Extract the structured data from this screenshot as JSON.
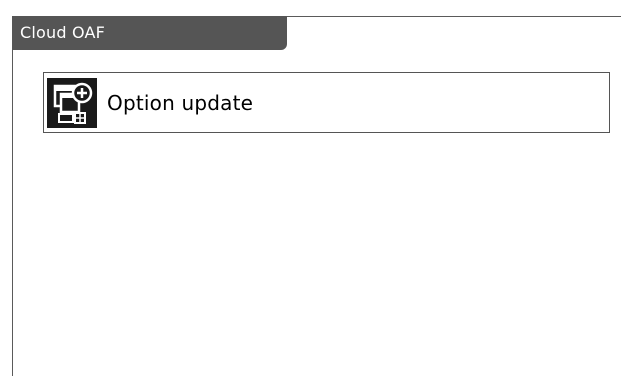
{
  "header": {
    "title": "Cloud OAF"
  },
  "options": [
    {
      "label": "Option update",
      "icon": "option-update-icon"
    }
  ],
  "colors": {
    "title_bar": "#555555",
    "title_text": "#ffffff",
    "icon_background": "#1a1a1a",
    "border": "#555555"
  }
}
